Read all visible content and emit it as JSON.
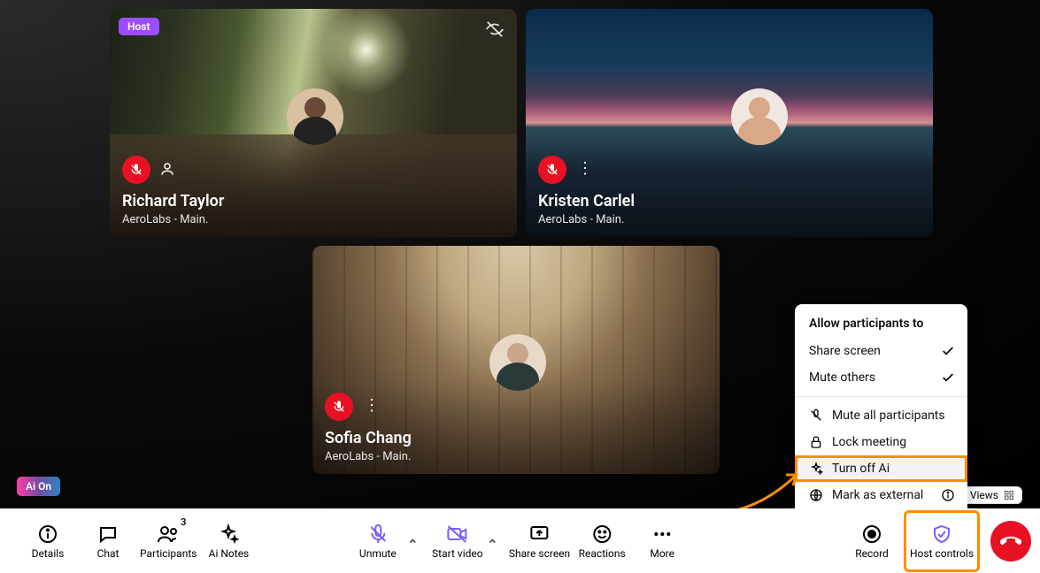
{
  "participants": [
    {
      "name": "Richard Taylor",
      "subtitle": "AeroLabs - Main.",
      "host_badge": "Host",
      "muted": true
    },
    {
      "name": "Kristen Carlel",
      "subtitle": "AeroLabs - Main.",
      "muted": true
    },
    {
      "name": "Sofia Chang",
      "subtitle": "AeroLabs - Main.",
      "muted": true
    }
  ],
  "ai_badge": "Ai On",
  "toolbar": {
    "details": "Details",
    "chat": "Chat",
    "participants": "Participants",
    "participants_count": "3",
    "ai_notes": "Ai Notes",
    "unmute": "Unmute",
    "start_video": "Start video",
    "share_screen": "Share screen",
    "reactions": "Reactions",
    "more": "More",
    "record": "Record",
    "host_controls": "Host controls"
  },
  "views_label": "Views",
  "host_menu": {
    "title": "Allow participants to",
    "share_screen": "Share screen",
    "mute_others": "Mute others",
    "mute_all": "Mute all participants",
    "lock_meeting": "Lock meeting",
    "turn_off_ai": "Turn off Ai",
    "mark_external": "Mark as external"
  }
}
